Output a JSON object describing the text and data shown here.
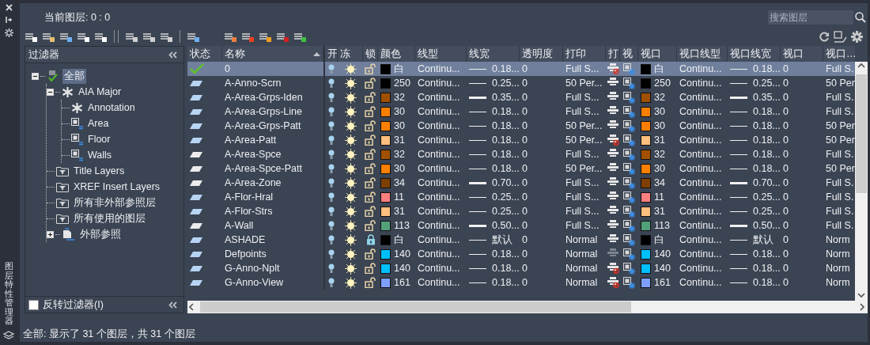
{
  "side_title": "图层特性管理器",
  "current_layer": "当前图层: 0 : 0",
  "search": {
    "placeholder": "搜索图层"
  },
  "filters": {
    "title": "过滤器",
    "tree": [
      {
        "label": "全部",
        "kind": "all",
        "selected": true,
        "expanded": true,
        "children": [
          {
            "label": "AIA Major",
            "kind": "group",
            "selected": false,
            "expanded": true,
            "children": [
              {
                "label": "Annotation",
                "kind": "group",
                "selected": false
              },
              {
                "label": "Area",
                "kind": "property",
                "selected": false
              },
              {
                "label": "Floor",
                "kind": "property",
                "selected": false
              },
              {
                "label": "Walls",
                "kind": "property",
                "selected": false
              }
            ]
          },
          {
            "label": "Title Layers",
            "kind": "folder",
            "selected": false
          },
          {
            "label": "XREF Insert Layers",
            "kind": "folder",
            "selected": false
          },
          {
            "label": "所有非外部参照层",
            "kind": "folder",
            "selected": false
          },
          {
            "label": "所有使用的图层",
            "kind": "folder",
            "selected": false
          },
          {
            "label": "外部参照",
            "kind": "xref",
            "selected": false,
            "expanded": false
          }
        ]
      }
    ],
    "invert": {
      "label": "反转过滤器(I)",
      "checked": false
    }
  },
  "table": {
    "columns": [
      "状态",
      "名称",
      "开",
      "冻",
      "锁",
      "颜色",
      "线型",
      "线宽",
      "透明度",
      "打印",
      "打",
      "视",
      "视口",
      "视口线型",
      "视口线宽",
      "视口",
      "视口…"
    ],
    "rows": [
      {
        "kind": "current",
        "name": "0",
        "selected": true,
        "on": true,
        "frozen": false,
        "locked": false,
        "color": "#000000",
        "color_label": "白",
        "linetype": "Continu...",
        "lineweight": "0.18...",
        "lw_heavy": false,
        "transparency": "0",
        "plot_style": "Full S...",
        "plot": false,
        "plot_disabled": false,
        "vp_frozen": true,
        "viewport": {
          "color": "#000000",
          "color_label": "白",
          "linetype": "Continu...",
          "lineweight": "0.18...",
          "transparency": "0",
          "plot_style": "Full S."
        }
      },
      {
        "kind": "used",
        "name": "A-Anno-Scrn",
        "selected": false,
        "on": true,
        "frozen": false,
        "locked": false,
        "color": "#000000",
        "color_label": "250",
        "linetype": "Continu...",
        "lineweight": "0.25...",
        "lw_heavy": false,
        "transparency": "0",
        "plot_style": "50 Per...",
        "plot": true,
        "plot_disabled": false,
        "vp_frozen": true,
        "viewport": {
          "color": "#000000",
          "color_label": "250",
          "linetype": "Continu...",
          "lineweight": "0.25...",
          "transparency": "0",
          "plot_style": "50 Per"
        }
      },
      {
        "kind": "used",
        "name": "A-Area-Grps-Iden",
        "selected": false,
        "on": true,
        "frozen": false,
        "locked": false,
        "color": "#a05000",
        "color_label": "32",
        "linetype": "Continu...",
        "lineweight": "0.35...",
        "lw_heavy": true,
        "transparency": "0",
        "plot_style": "Full S...",
        "plot": true,
        "plot_disabled": false,
        "vp_frozen": true,
        "viewport": {
          "color": "#a05000",
          "color_label": "32",
          "linetype": "Continu...",
          "lineweight": "0.35...",
          "transparency": "0",
          "plot_style": "Full S."
        }
      },
      {
        "kind": "used",
        "name": "A-Area-Grps-Line",
        "selected": false,
        "on": true,
        "frozen": false,
        "locked": false,
        "color": "#ff7f00",
        "color_label": "30",
        "linetype": "Continu...",
        "lineweight": "0.18...",
        "lw_heavy": false,
        "transparency": "0",
        "plot_style": "Full S...",
        "plot": true,
        "plot_disabled": false,
        "vp_frozen": true,
        "viewport": {
          "color": "#ff7f00",
          "color_label": "30",
          "linetype": "Continu...",
          "lineweight": "0.18...",
          "transparency": "0",
          "plot_style": "Full S."
        }
      },
      {
        "kind": "used",
        "name": "A-Area-Grps-Patt",
        "selected": false,
        "on": true,
        "frozen": false,
        "locked": false,
        "color": "#ff7f00",
        "color_label": "30",
        "linetype": "Continu...",
        "lineweight": "0.18...",
        "lw_heavy": false,
        "transparency": "0",
        "plot_style": "50 Per...",
        "plot": true,
        "plot_disabled": false,
        "vp_frozen": true,
        "viewport": {
          "color": "#ff7f00",
          "color_label": "30",
          "linetype": "Continu...",
          "lineweight": "0.18...",
          "transparency": "0",
          "plot_style": "50 Per"
        }
      },
      {
        "kind": "used",
        "name": "A-Area-Patt",
        "selected": false,
        "on": true,
        "frozen": false,
        "locked": false,
        "color": "#ffbf7f",
        "color_label": "31",
        "linetype": "Continu...",
        "lineweight": "0.18...",
        "lw_heavy": false,
        "transparency": "0",
        "plot_style": "50 Per...",
        "plot": false,
        "plot_disabled": false,
        "vp_frozen": true,
        "viewport": {
          "color": "#ffbf7f",
          "color_label": "31",
          "linetype": "Continu...",
          "lineweight": "0.18...",
          "transparency": "0",
          "plot_style": "50 Per"
        }
      },
      {
        "kind": "unused",
        "name": "A-Area-Spce",
        "selected": false,
        "on": true,
        "frozen": false,
        "locked": false,
        "color": "#a05000",
        "color_label": "32",
        "linetype": "Continu...",
        "lineweight": "0.18...",
        "lw_heavy": false,
        "transparency": "0",
        "plot_style": "Full S...",
        "plot": true,
        "plot_disabled": false,
        "vp_frozen": true,
        "viewport": {
          "color": "#a05000",
          "color_label": "32",
          "linetype": "Continu...",
          "lineweight": "0.18...",
          "transparency": "0",
          "plot_style": "Full S."
        }
      },
      {
        "kind": "unused",
        "name": "A-Area-Spce-Patt",
        "selected": false,
        "on": true,
        "frozen": false,
        "locked": false,
        "color": "#ff7f00",
        "color_label": "30",
        "linetype": "Continu...",
        "lineweight": "0.18...",
        "lw_heavy": false,
        "transparency": "0",
        "plot_style": "50 Per...",
        "plot": true,
        "plot_disabled": false,
        "vp_frozen": true,
        "viewport": {
          "color": "#ff7f00",
          "color_label": "30",
          "linetype": "Continu...",
          "lineweight": "0.18...",
          "transparency": "0",
          "plot_style": "50 Per"
        }
      },
      {
        "kind": "unused",
        "name": "A-Area-Zone",
        "selected": false,
        "on": true,
        "frozen": false,
        "locked": false,
        "color": "#7f3f00",
        "color_label": "34",
        "linetype": "Continu...",
        "lineweight": "0.70...",
        "lw_heavy": true,
        "transparency": "0",
        "plot_style": "Full S...",
        "plot": true,
        "plot_disabled": false,
        "vp_frozen": true,
        "viewport": {
          "color": "#7f3f00",
          "color_label": "34",
          "linetype": "Continu...",
          "lineweight": "0.70...",
          "transparency": "0",
          "plot_style": "Full S."
        }
      },
      {
        "kind": "used",
        "name": "A-Flor-Hral",
        "selected": false,
        "on": true,
        "frozen": false,
        "locked": false,
        "color": "#ff7f7f",
        "color_label": "11",
        "linetype": "Continu...",
        "lineweight": "0.25...",
        "lw_heavy": false,
        "transparency": "0",
        "plot_style": "Full S...",
        "plot": true,
        "plot_disabled": false,
        "vp_frozen": true,
        "viewport": {
          "color": "#ff7f7f",
          "color_label": "11",
          "linetype": "Continu...",
          "lineweight": "0.25...",
          "transparency": "0",
          "plot_style": "Full S."
        }
      },
      {
        "kind": "used",
        "name": "A-Flor-Strs",
        "selected": false,
        "on": true,
        "frozen": false,
        "locked": false,
        "color": "#ffbf7f",
        "color_label": "31",
        "linetype": "Continu...",
        "lineweight": "0.25...",
        "lw_heavy": false,
        "transparency": "0",
        "plot_style": "Full S...",
        "plot": true,
        "plot_disabled": false,
        "vp_frozen": true,
        "viewport": {
          "color": "#ffbf7f",
          "color_label": "31",
          "linetype": "Continu...",
          "lineweight": "0.25...",
          "transparency": "0",
          "plot_style": "Full S."
        }
      },
      {
        "kind": "unused",
        "name": "A-Wall",
        "selected": false,
        "on": true,
        "frozen": false,
        "locked": false,
        "color": "#52a07a",
        "color_label": "113",
        "linetype": "Continu...",
        "lineweight": "0.50...",
        "lw_heavy": true,
        "transparency": "0",
        "plot_style": "Full S...",
        "plot": true,
        "plot_disabled": false,
        "vp_frozen": true,
        "viewport": {
          "color": "#52a07a",
          "color_label": "113",
          "linetype": "Continu...",
          "lineweight": "0.50...",
          "transparency": "0",
          "plot_style": "Full S."
        }
      },
      {
        "kind": "used",
        "name": "ASHADE",
        "selected": false,
        "on": true,
        "frozen": false,
        "locked": true,
        "color": "#000000",
        "color_label": "白",
        "linetype": "Continu...",
        "lineweight": "默认",
        "lw_heavy": false,
        "transparency": "0",
        "plot_style": "Normal",
        "plot": true,
        "plot_disabled": false,
        "vp_frozen": true,
        "viewport": {
          "color": "#000000",
          "color_label": "白",
          "linetype": "Continu...",
          "lineweight": "默认",
          "transparency": "0",
          "plot_style": "Norm"
        }
      },
      {
        "kind": "used",
        "name": "Defpoints",
        "selected": false,
        "on": true,
        "frozen": false,
        "locked": false,
        "color": "#00bfff",
        "color_label": "140",
        "linetype": "Continu...",
        "lineweight": "0.18...",
        "lw_heavy": false,
        "transparency": "0",
        "plot_style": "Normal",
        "plot": true,
        "plot_disabled": true,
        "vp_frozen": true,
        "viewport": {
          "color": "#00bfff",
          "color_label": "140",
          "linetype": "Continu...",
          "lineweight": "0.18...",
          "transparency": "0",
          "plot_style": "Norm"
        }
      },
      {
        "kind": "used",
        "name": "G-Anno-Nplt",
        "selected": false,
        "on": true,
        "frozen": false,
        "locked": false,
        "color": "#00bfff",
        "color_label": "140",
        "linetype": "Continu...",
        "lineweight": "0.18...",
        "lw_heavy": false,
        "transparency": "0",
        "plot_style": "Normal",
        "plot": false,
        "plot_disabled": false,
        "vp_frozen": true,
        "viewport": {
          "color": "#00bfff",
          "color_label": "140",
          "linetype": "Continu...",
          "lineweight": "0.18...",
          "transparency": "0",
          "plot_style": "Norm"
        }
      },
      {
        "kind": "used",
        "name": "G-Anno-View",
        "selected": false,
        "on": true,
        "frozen": false,
        "locked": false,
        "color": "#7f9fff",
        "color_label": "161",
        "linetype": "Continu...",
        "lineweight": "0.18...",
        "lw_heavy": false,
        "transparency": "0",
        "plot_style": "Normal",
        "plot": false,
        "plot_disabled": false,
        "vp_frozen": true,
        "viewport": {
          "color": "#7f9fff",
          "color_label": "161",
          "linetype": "Continu...",
          "lineweight": "0.18...",
          "transparency": "0",
          "plot_style": "Norm"
        }
      }
    ]
  },
  "status_bar": "全部: 显示了 31 个图层，共 31 个图层"
}
